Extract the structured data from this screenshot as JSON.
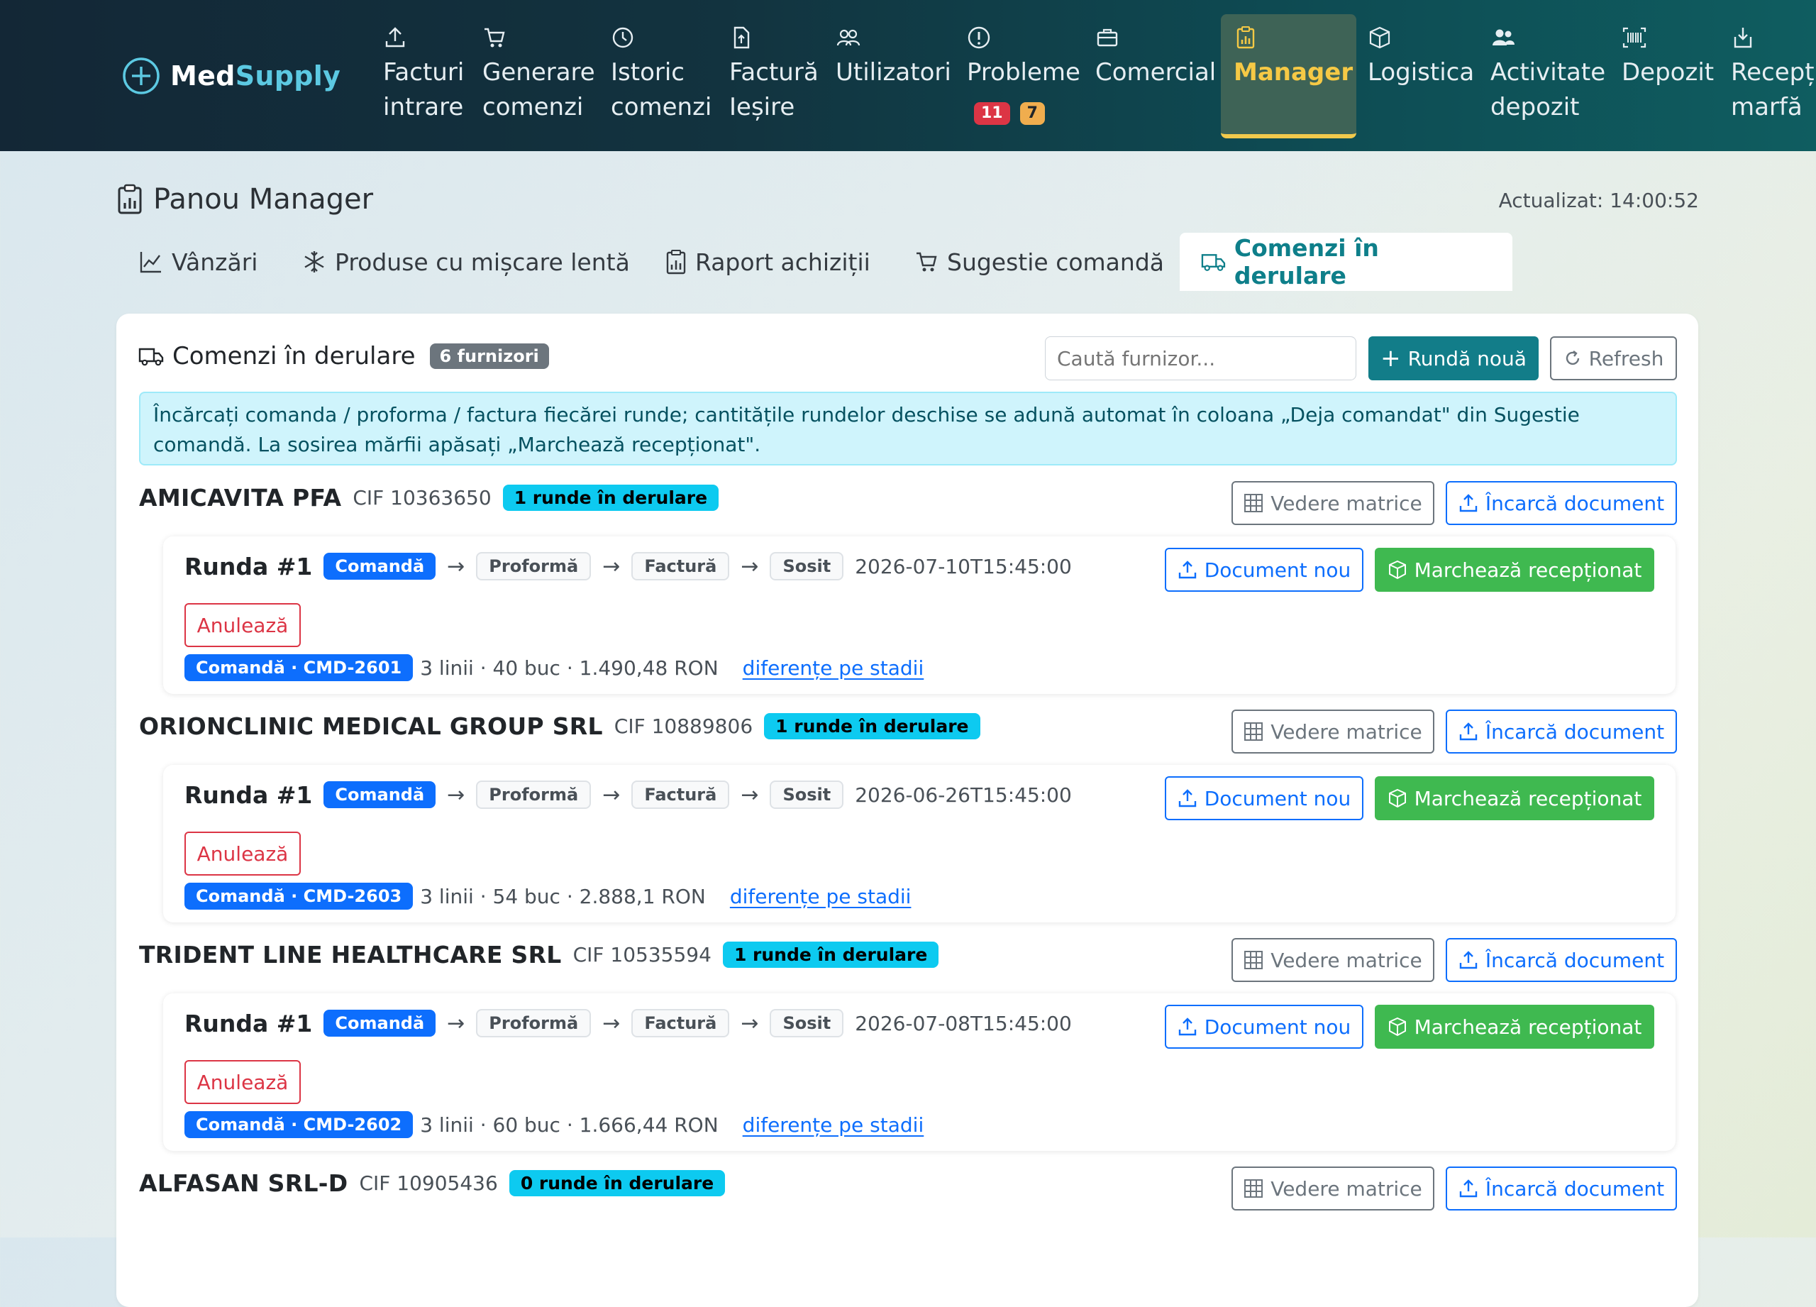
{
  "brand": {
    "name_part1": "Med",
    "name_part2": "Supply"
  },
  "nav": [
    {
      "line1": "Facturi",
      "line2": "intrare",
      "icon": "upload-icon"
    },
    {
      "line1": "Generare",
      "line2": "comenzi",
      "icon": "cart-icon"
    },
    {
      "line1": "Istoric",
      "line2": "comenzi",
      "icon": "clock-icon"
    },
    {
      "line1": "Factură",
      "line2": "Ieșire",
      "icon": "file-arrow-up-icon"
    },
    {
      "line1": "Utilizatori",
      "line2": "",
      "icon": "users-icon"
    },
    {
      "line1": "Probleme",
      "line2": "",
      "icon": "alert-circle-icon",
      "badges": [
        "11",
        "7"
      ]
    },
    {
      "line1": "Comercial",
      "line2": "",
      "icon": "briefcase-icon"
    },
    {
      "line1": "Manager",
      "line2": "",
      "icon": "clipboard-chart-icon",
      "active": true
    },
    {
      "line1": "Logistica",
      "line2": "",
      "icon": "box-icon"
    },
    {
      "line1": "Activitate",
      "line2": "depozit",
      "icon": "people-icon"
    },
    {
      "line1": "Depozit",
      "line2": "",
      "icon": "barcode-icon"
    },
    {
      "line1": "Recepți",
      "line2": "marfă",
      "icon": "download-box-icon"
    }
  ],
  "page": {
    "title": "Panou Manager",
    "updated": "Actualizat: 14:00:52"
  },
  "tabs": [
    {
      "label": "Vânzări",
      "icon": "chart-line-icon"
    },
    {
      "label": "Produse cu mișcare lentă",
      "icon": "snowflake-icon"
    },
    {
      "label": "Raport achiziții",
      "icon": "clipboard-chart-icon"
    },
    {
      "label": "Sugestie comandă",
      "icon": "cart-icon"
    },
    {
      "label": "Comenzi în derulare",
      "icon": "truck-icon",
      "active": true
    }
  ],
  "card": {
    "title": "Comenzi în derulare",
    "suppliers_count": "6 furnizori",
    "search_placeholder": "Caută furnizor...",
    "new_round_label": "Rundă nouă",
    "refresh_label": "Refresh",
    "info": "Încărcați comanda / proforma / factura fiecărei runde; cantitățile rundelor deschise se adună automat în coloana „Deja comandat\" din Sugestie comandă. La sosirea mărfii apăsați „Marchează recepționat\"."
  },
  "labels": {
    "matrix": "Vedere matrice",
    "upload": "Încarcă document",
    "new_doc": "Document nou",
    "mark_received": "Marchează recepționat",
    "cancel": "Anulează",
    "diff": "diferențe pe stadii",
    "stage_order": "Comandă",
    "stage_proforma": "Proformă",
    "stage_invoice": "Factură",
    "stage_arrived": "Sosit"
  },
  "suppliers": [
    {
      "name": "AMICAVITA PFA",
      "cif": "CIF 10363650",
      "rounds_badge": "1 runde în derulare",
      "round": {
        "title": "Runda #1",
        "date": "2026-07-10T15:45:00",
        "doc_badge": "Comandă · CMD-2601",
        "summary": "3 linii · 40 buc · 1.490,48 RON"
      }
    },
    {
      "name": "ORIONCLINIC MEDICAL GROUP SRL",
      "cif": "CIF 10889806",
      "rounds_badge": "1 runde în derulare",
      "round": {
        "title": "Runda #1",
        "date": "2026-06-26T15:45:00",
        "doc_badge": "Comandă · CMD-2603",
        "summary": "3 linii · 54 buc · 2.888,1 RON"
      }
    },
    {
      "name": "TRIDENT LINE HEALTHCARE SRL",
      "cif": "CIF 10535594",
      "rounds_badge": "1 runde în derulare",
      "round": {
        "title": "Runda #1",
        "date": "2026-07-08T15:45:00",
        "doc_badge": "Comandă · CMD-2602",
        "summary": "3 linii · 60 buc · 1.666,44 RON"
      }
    },
    {
      "name": "ALFASAN SRL-D",
      "cif": "CIF 10905436",
      "rounds_badge": "0 runde în derulare"
    }
  ],
  "colors": {
    "accent": "#127d89",
    "primary": "#0d6efd",
    "success": "#3fb950",
    "danger": "#dc3545",
    "active_nav": "#f6c945"
  }
}
